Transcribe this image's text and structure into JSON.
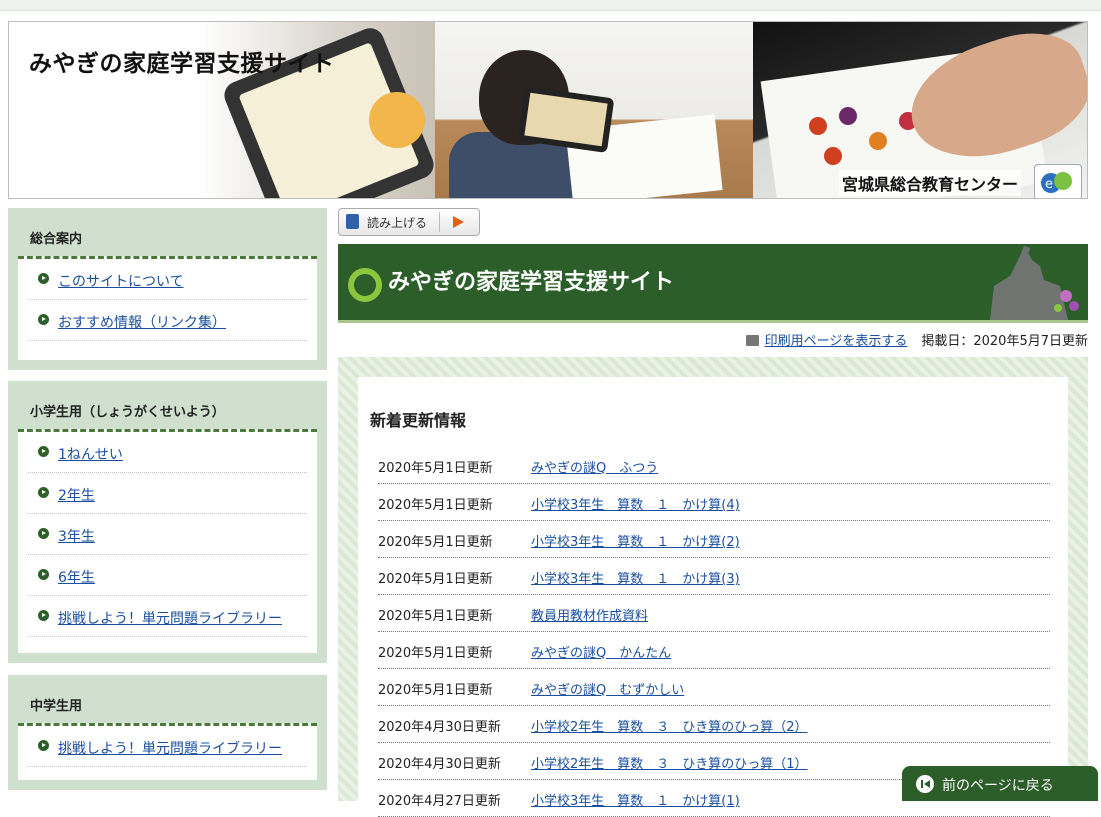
{
  "banner": {
    "title": "みやぎの家庭学習支援サイト",
    "center_name": "宮城県総合教育センター"
  },
  "sidebar": [
    {
      "heading": "総合案内",
      "items": [
        "このサイトについて",
        "おすすめ情報（リンク集）"
      ]
    },
    {
      "heading": "小学生用（しょうがくせいよう）",
      "items": [
        "1ねんせい",
        "2年生",
        "3年生",
        "6年生",
        "挑戦しよう！単元問題ライブラリー"
      ]
    },
    {
      "heading": "中学生用",
      "items": [
        "挑戦しよう！単元問題ライブラリー"
      ]
    }
  ],
  "readaloud": {
    "label": "読み上げる"
  },
  "page": {
    "title": "みやぎの家庭学習支援サイト",
    "print_link": "印刷用ページを表示する",
    "posted_date": "掲載日：2020年5月7日更新"
  },
  "news": {
    "title": "新着更新情報",
    "rows": [
      {
        "date": "2020年5月1日更新",
        "link": "みやぎの謎Q　ふつう"
      },
      {
        "date": "2020年5月1日更新",
        "link": "小学校3年生　算数　１　かけ算(4)"
      },
      {
        "date": "2020年5月1日更新",
        "link": "小学校3年生　算数　１　かけ算(2)"
      },
      {
        "date": "2020年5月1日更新",
        "link": "小学校3年生　算数　１　かけ算(3)"
      },
      {
        "date": "2020年5月1日更新",
        "link": "教員用教材作成資料"
      },
      {
        "date": "2020年5月1日更新",
        "link": "みやぎの謎Q　かんたん"
      },
      {
        "date": "2020年5月1日更新",
        "link": "みやぎの謎Q　むずかしい"
      },
      {
        "date": "2020年4月30日更新",
        "link": "小学校2年生　算数　３　ひき算のひっ算（2）"
      },
      {
        "date": "2020年4月30日更新",
        "link": "小学校2年生　算数　３　ひき算のひっ算（1）"
      },
      {
        "date": "2020年4月27日更新",
        "link": "小学校3年生　算数　１　かけ算(1)"
      }
    ]
  },
  "back_button": {
    "label": "前のページに戻る"
  }
}
